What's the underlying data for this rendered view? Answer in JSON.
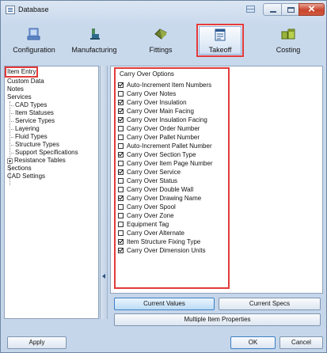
{
  "window": {
    "title": "Database"
  },
  "ribbon": {
    "tabs": [
      {
        "label": "Configuration",
        "icon": "configuration-icon"
      },
      {
        "label": "Manufacturing",
        "icon": "manufacturing-icon"
      },
      {
        "label": "Fittings",
        "icon": "fittings-icon"
      },
      {
        "label": "Takeoff",
        "icon": "takeoff-icon",
        "active": true
      },
      {
        "label": "Costing",
        "icon": "costing-icon"
      }
    ]
  },
  "nav": {
    "items": [
      "Item Entry",
      "Custom Data",
      "Notes",
      "Services",
      "CAD Types",
      "Item Statuses",
      "Service Types",
      "Layering",
      "Fluid Types",
      "Structure Types",
      "Support Specifications",
      "Resistance Tables",
      "Sections",
      "CAD Settings"
    ]
  },
  "options": {
    "title": "Carry Over Options",
    "items": [
      {
        "label": "Auto-Increment Item Numbers",
        "checked": true
      },
      {
        "label": "Carry Over Notes",
        "checked": false
      },
      {
        "label": "Carry Over Insulation",
        "checked": true
      },
      {
        "label": "Carry Over Main Facing",
        "checked": true
      },
      {
        "label": "Carry Over Insulation Facing",
        "checked": true
      },
      {
        "label": "Carry Over Order Number",
        "checked": false
      },
      {
        "label": "Carry Over Pallet Number",
        "checked": false
      },
      {
        "label": "Auto-Increment Pallet Number",
        "checked": false
      },
      {
        "label": "Carry Over Section Type",
        "checked": true
      },
      {
        "label": "Carry Over Item Page Number",
        "checked": false
      },
      {
        "label": "Carry Over Service",
        "checked": true
      },
      {
        "label": "Carry Over Status",
        "checked": false
      },
      {
        "label": "Carry Over Double Wall",
        "checked": false
      },
      {
        "label": "Carry Over Drawing Name",
        "checked": true
      },
      {
        "label": "Carry Over Spool",
        "checked": false
      },
      {
        "label": "Carry Over Zone",
        "checked": false
      },
      {
        "label": "Equipment Tag",
        "checked": false
      },
      {
        "label": "Carry Over Alternate",
        "checked": false
      },
      {
        "label": "Item Structure Fixing Type",
        "checked": true
      },
      {
        "label": "Carry Over Dimension Units",
        "checked": true
      }
    ]
  },
  "buttons": {
    "current_values": "Current Values",
    "current_specs": "Current Specs",
    "multiple_item_properties": "Multiple Item Properties",
    "apply": "Apply",
    "ok": "OK",
    "cancel": "Cancel"
  },
  "colors": {
    "highlight": "#e23a3a",
    "accent": "#3b7fc4"
  }
}
